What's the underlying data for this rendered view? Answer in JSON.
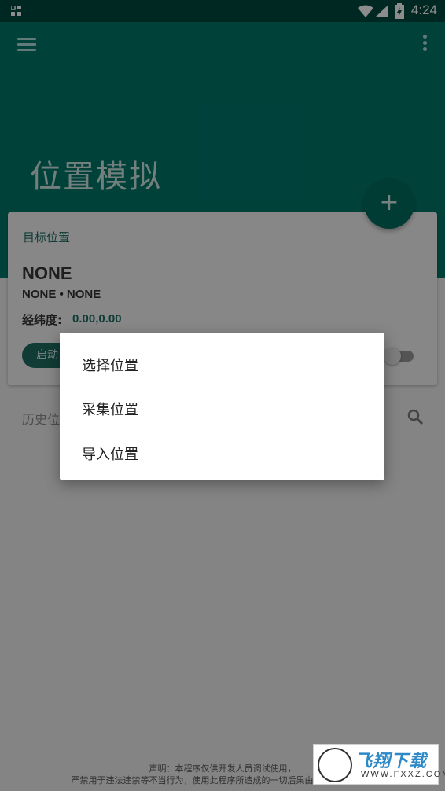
{
  "status_bar": {
    "time": "4:24",
    "icons": [
      "notification-icon",
      "wifi-icon",
      "signal-icon",
      "battery-charging-icon"
    ]
  },
  "app_bar": {
    "title": "位置模拟",
    "menu_icon": "menu-icon",
    "more_icon": "more-vert-icon",
    "fab_label": "+",
    "color": "#00796b"
  },
  "target_card": {
    "header": "目标位置",
    "location_name": "NONE",
    "location_detail": "NONE • NONE",
    "coord_label": "经纬度:",
    "coord_value": "0.00,0.00",
    "start_button": "启动",
    "toggle_on": false
  },
  "history": {
    "label": "历史位",
    "search_icon": "search-icon"
  },
  "dialog": {
    "items": [
      "选择位置",
      "采集位置",
      "导入位置"
    ]
  },
  "footer": {
    "line1": "声明：本程序仅供开发人员调试使用，",
    "line2": "严禁用于违法违禁等不当行为，使用此程序所造成的一切后果由用户自行承担。"
  },
  "watermark": {
    "main": "飞翔下载",
    "sub": "WWW.FXXZ.COM"
  },
  "colors": {
    "primary": "#00796b",
    "primary_dark": "#004a40",
    "accent_text": "#1f6d63"
  }
}
